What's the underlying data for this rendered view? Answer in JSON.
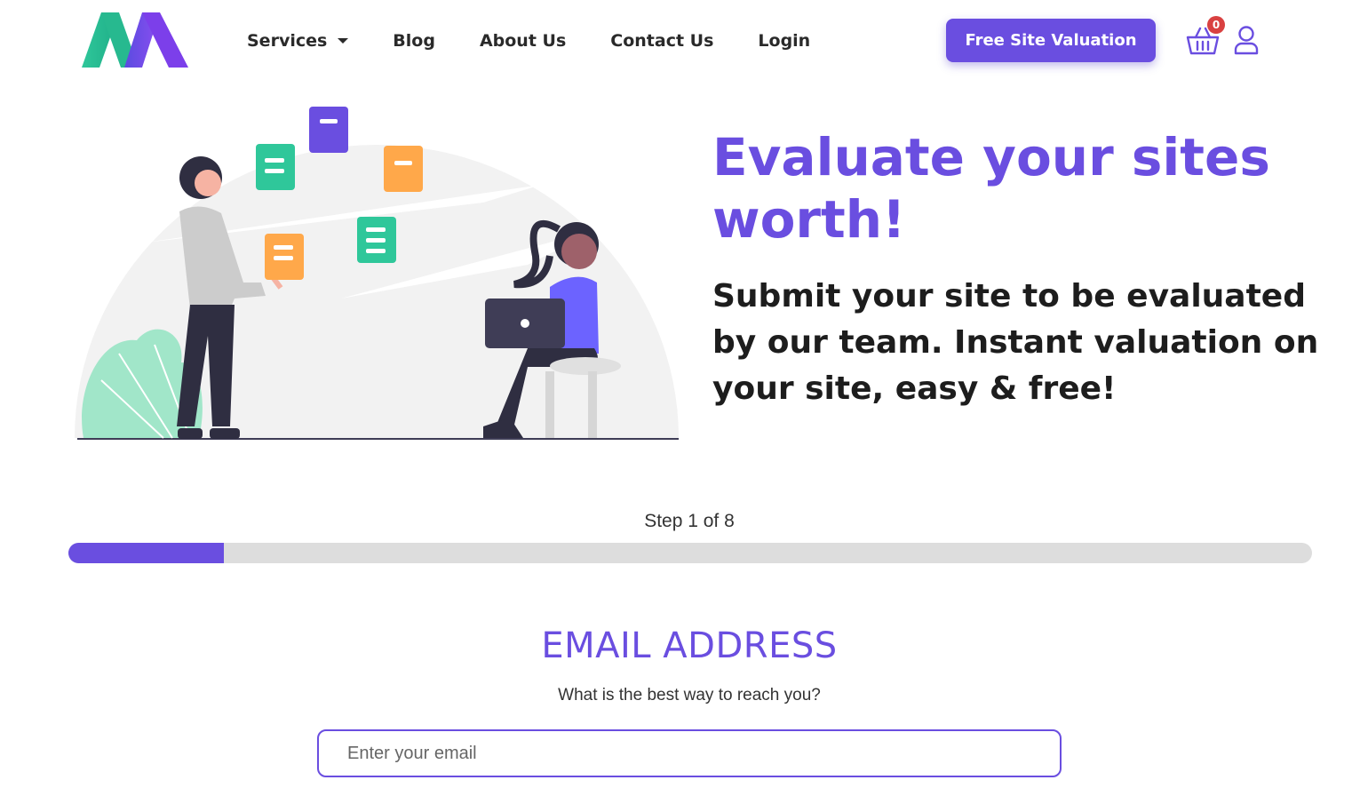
{
  "nav": {
    "items": [
      {
        "label": "Services",
        "has_dropdown": true
      },
      {
        "label": "Blog"
      },
      {
        "label": "About Us"
      },
      {
        "label": "Contact Us"
      },
      {
        "label": "Login"
      }
    ],
    "cta_label": "Free Site Valuation",
    "cart_count": "0"
  },
  "hero": {
    "title": "Evaluate your sites worth!",
    "subtitle": "Submit your site to be evaluated by our team. Instant valuation on your site, easy & free!"
  },
  "form": {
    "step_label": "Step 1 of 8",
    "progress_fraction": 0.125,
    "field_title": "EMAIL ADDRESS",
    "field_help": "What is the best way to reach you?",
    "email_placeholder": "Enter your email",
    "email_value": ""
  },
  "colors": {
    "accent": "#6a4ee0",
    "progress_track": "#dddddd",
    "badge": "#d94141"
  },
  "icons": {
    "cart": "shopping-basket-icon",
    "user": "user-icon",
    "dropdown": "caret-down-icon"
  }
}
